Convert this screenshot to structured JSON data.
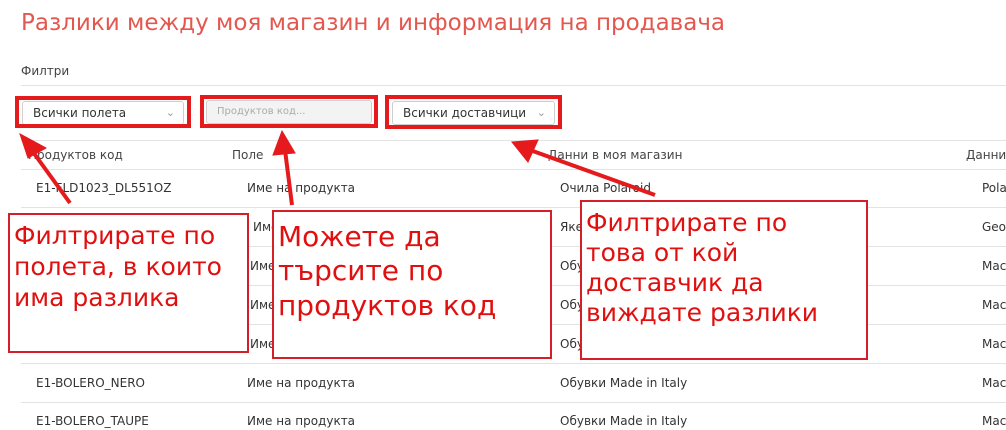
{
  "page": {
    "title": "Разлики между моя магазин и информация на продавача"
  },
  "filters": {
    "label": "Филтри",
    "fields_select": "Всички полета",
    "code_placeholder": "Продуктов код...",
    "supplier_select": "Всички доставчици"
  },
  "table": {
    "headers": [
      "Продуктов код",
      "Поле",
      "Данни в моя магазин",
      "Данни"
    ],
    "rows": [
      [
        "E1-FLD1023_DL551OZ",
        "Име на продукта",
        "Очила Polaroid",
        "Pola"
      ],
      [
        "",
        "Име",
        "Яке",
        "Geo"
      ],
      [
        "",
        "Име",
        "Обу",
        "Mac"
      ],
      [
        "",
        "Име",
        "Обу",
        "Mac"
      ],
      [
        "",
        "Име",
        "Обу",
        "Mac"
      ],
      [
        "E1-BOLERO_NERO",
        "Име на продукта",
        "Обувки Made in Italy",
        "Mac"
      ],
      [
        "E1-BOLERO_TAUPE",
        "Име на продукта",
        "Обувки Made in Italy",
        "Mac"
      ]
    ]
  },
  "annotations": {
    "fields": [
      "Филтрирате по",
      "полета, в които",
      "има разлика"
    ],
    "code": [
      "Можете да",
      "търсите по",
      "продуктов код"
    ],
    "supplier": [
      "Филтрирате по",
      "това от кой",
      "доставчик да",
      "виждате разлики"
    ]
  },
  "colors": {
    "title": "#e4574f",
    "annotation": "#e41a1c"
  }
}
